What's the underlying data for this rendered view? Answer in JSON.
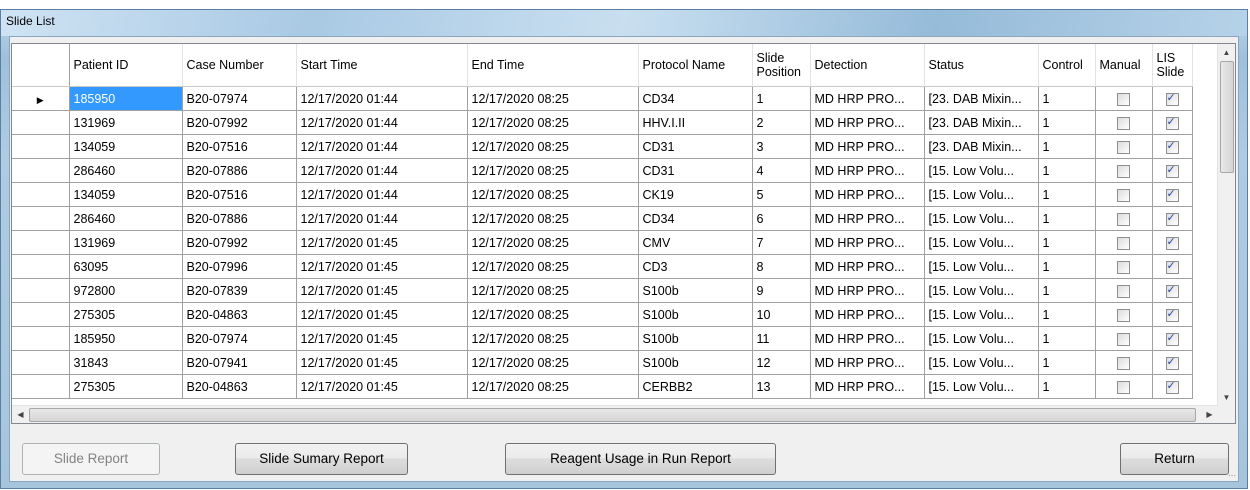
{
  "window": {
    "title": "Slide List"
  },
  "columns": [
    "",
    "Patient ID",
    "Case Number",
    "Start Time",
    "End Time",
    "Protocol Name",
    "Slide Position",
    "Detection",
    "Status",
    "Control",
    "Manual",
    "LIS Slide"
  ],
  "rows": [
    {
      "patient_id": "185950",
      "case_number": "B20-07974",
      "start_time": "12/17/2020 01:44",
      "end_time": "12/17/2020 08:25",
      "protocol": "CD34",
      "position": "1",
      "detection": "MD HRP PRO...",
      "status": "[23. DAB Mixin...",
      "control": "1",
      "manual": false,
      "lis": true,
      "selected": true
    },
    {
      "patient_id": "131969",
      "case_number": "B20-07992",
      "start_time": "12/17/2020 01:44",
      "end_time": "12/17/2020 08:25",
      "protocol": "HHV.I.II",
      "position": "2",
      "detection": "MD HRP PRO...",
      "status": "[23. DAB Mixin...",
      "control": "1",
      "manual": false,
      "lis": true
    },
    {
      "patient_id": "134059",
      "case_number": "B20-07516",
      "start_time": "12/17/2020 01:44",
      "end_time": "12/17/2020 08:25",
      "protocol": "CD31",
      "position": "3",
      "detection": "MD HRP PRO...",
      "status": "[23. DAB Mixin...",
      "control": "1",
      "manual": false,
      "lis": true
    },
    {
      "patient_id": "286460",
      "case_number": "B20-07886",
      "start_time": "12/17/2020 01:44",
      "end_time": "12/17/2020 08:25",
      "protocol": "CD31",
      "position": "4",
      "detection": "MD HRP PRO...",
      "status": "[15. Low Volu...",
      "control": "1",
      "manual": false,
      "lis": true
    },
    {
      "patient_id": "134059",
      "case_number": "B20-07516",
      "start_time": "12/17/2020 01:44",
      "end_time": "12/17/2020 08:25",
      "protocol": "CK19",
      "position": "5",
      "detection": "MD HRP PRO...",
      "status": "[15. Low Volu...",
      "control": "1",
      "manual": false,
      "lis": true
    },
    {
      "patient_id": "286460",
      "case_number": "B20-07886",
      "start_time": "12/17/2020 01:44",
      "end_time": "12/17/2020 08:25",
      "protocol": "CD34",
      "position": "6",
      "detection": "MD HRP PRO...",
      "status": "[15. Low Volu...",
      "control": "1",
      "manual": false,
      "lis": true
    },
    {
      "patient_id": "131969",
      "case_number": "B20-07992",
      "start_time": "12/17/2020 01:45",
      "end_time": "12/17/2020 08:25",
      "protocol": "CMV",
      "position": "7",
      "detection": "MD HRP PRO...",
      "status": "[15. Low Volu...",
      "control": "1",
      "manual": false,
      "lis": true
    },
    {
      "patient_id": "63095",
      "case_number": "B20-07996",
      "start_time": "12/17/2020 01:45",
      "end_time": "12/17/2020 08:25",
      "protocol": "CD3",
      "position": "8",
      "detection": "MD HRP PRO...",
      "status": "[15. Low Volu...",
      "control": "1",
      "manual": false,
      "lis": true
    },
    {
      "patient_id": "972800",
      "case_number": "B20-07839",
      "start_time": "12/17/2020 01:45",
      "end_time": "12/17/2020 08:25",
      "protocol": "S100b",
      "position": "9",
      "detection": "MD HRP PRO...",
      "status": "[15. Low Volu...",
      "control": "1",
      "manual": false,
      "lis": true
    },
    {
      "patient_id": "275305",
      "case_number": "B20-04863",
      "start_time": "12/17/2020 01:45",
      "end_time": "12/17/2020 08:25",
      "protocol": "S100b",
      "position": "10",
      "detection": "MD HRP PRO...",
      "status": "[15. Low Volu...",
      "control": "1",
      "manual": false,
      "lis": true
    },
    {
      "patient_id": "185950",
      "case_number": "B20-07974",
      "start_time": "12/17/2020 01:45",
      "end_time": "12/17/2020 08:25",
      "protocol": "S100b",
      "position": "11",
      "detection": "MD HRP PRO...",
      "status": "[15. Low Volu...",
      "control": "1",
      "manual": false,
      "lis": true
    },
    {
      "patient_id": "31843",
      "case_number": "B20-07941",
      "start_time": "12/17/2020 01:45",
      "end_time": "12/17/2020 08:25",
      "protocol": "S100b",
      "position": "12",
      "detection": "MD HRP PRO...",
      "status": "[15. Low Volu...",
      "control": "1",
      "manual": false,
      "lis": true
    },
    {
      "patient_id": "275305",
      "case_number": "B20-04863",
      "start_time": "12/17/2020 01:45",
      "end_time": "12/17/2020 08:25",
      "protocol": "CERBB2",
      "position": "13",
      "detection": "MD HRP PRO...",
      "status": "[15. Low Volu...",
      "control": "1",
      "manual": false,
      "lis": true
    }
  ],
  "buttons": {
    "slide_report": "Slide Report",
    "slide_summary_report": "Slide Sumary Report",
    "reagent_usage": "Reagent Usage in Run Report",
    "return": "Return"
  },
  "icons": {
    "row_pointer": "triangle-right-icon",
    "scroll_up": "scroll-up-arrow-icon",
    "scroll_down": "scroll-down-arrow-icon",
    "scroll_left": "scroll-left-arrow-icon",
    "scroll_right": "scroll-right-arrow-icon",
    "checkbox_checked": "checkbox-checked-icon",
    "checkbox_unchecked": "checkbox-unchecked-icon"
  },
  "colors": {
    "selection": "#3399ff",
    "window_frame": "#a6c5dd",
    "grid_line": "#a0a0a0"
  }
}
